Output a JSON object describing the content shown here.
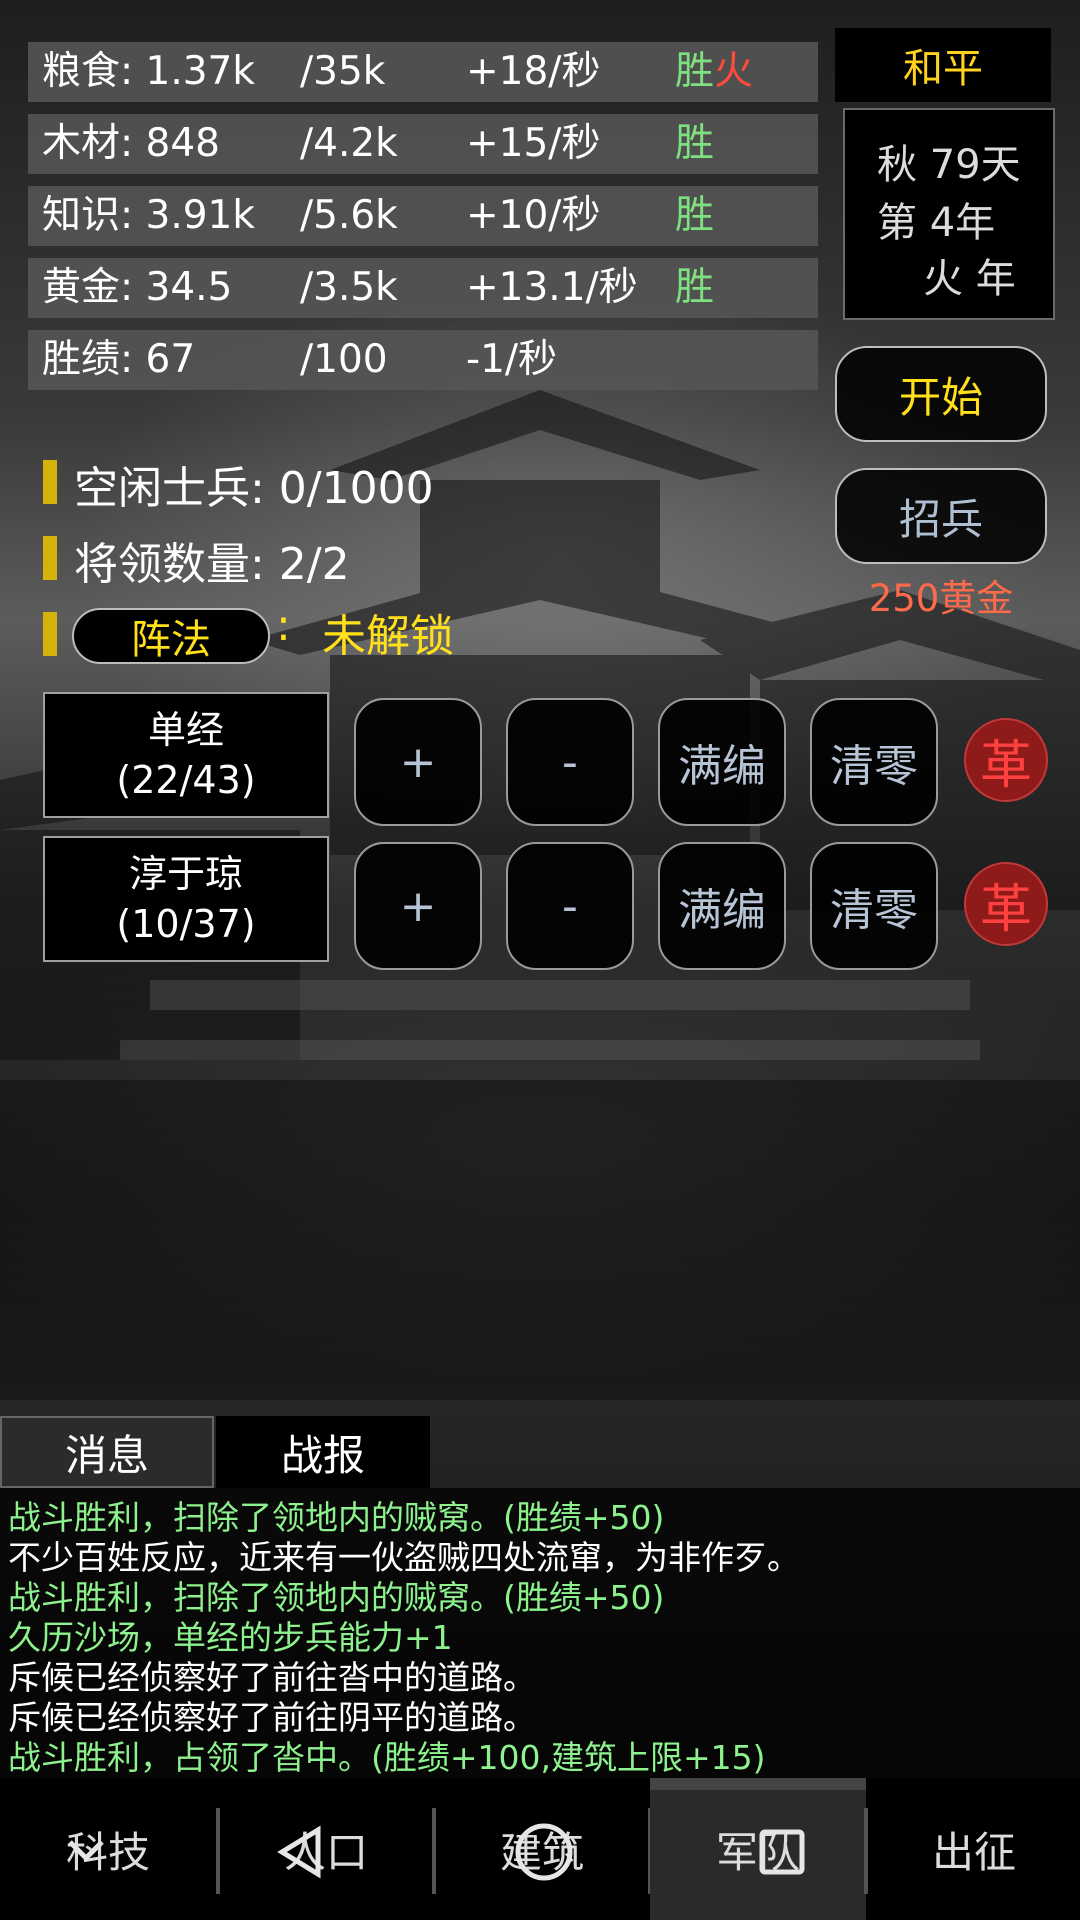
{
  "resources": [
    {
      "name": "粮食: 1.37k",
      "cap": "/35k",
      "rate": "+18/秒",
      "status": "胜",
      "extra": "火"
    },
    {
      "name": "木材: 848",
      "cap": "/4.2k",
      "rate": "+15/秒",
      "status": "胜",
      "extra": ""
    },
    {
      "name": "知识: 3.91k",
      "cap": "/5.6k",
      "rate": "+10/秒",
      "status": "胜",
      "extra": ""
    },
    {
      "name": "黄金: 34.5",
      "cap": "/3.5k",
      "rate": "+13.1/秒",
      "status": "胜",
      "extra": ""
    },
    {
      "name": "胜绩: 67",
      "cap": "/100",
      "rate": "-1/秒",
      "status": "",
      "extra": ""
    }
  ],
  "status_panel": {
    "state": "和平",
    "calendar": {
      "line1": "秋 79天",
      "line2": "第 4年",
      "line3": "火 年"
    },
    "start_label": "开始",
    "recruit_label": "招兵",
    "recruit_cost": "250黄金"
  },
  "military": {
    "idle_soldiers": "空闲士兵: 0/1000",
    "general_count": "将领数量: 2/2",
    "formation_label": "阵法",
    "formation_colon": ":",
    "formation_status": "未解锁"
  },
  "generals": [
    {
      "name": "单经",
      "troops": "(22/43)"
    },
    {
      "name": "淳于琼",
      "troops": "(10/37)"
    }
  ],
  "general_actions": {
    "add": "+",
    "remove": "-",
    "fill": "满编",
    "clear": "清零",
    "reform": "革"
  },
  "log_tabs": {
    "messages": "消息",
    "battle": "战报"
  },
  "log_lines": [
    {
      "text": "战斗胜利，扫除了领地内的贼窝。(胜绩+50)",
      "type": "good"
    },
    {
      "text": "不少百姓反应，近来有一伙盗贼四处流窜，为非作歹。",
      "type": "plain"
    },
    {
      "text": "战斗胜利，扫除了领地内的贼窝。(胜绩+50)",
      "type": "good"
    },
    {
      "text": "久历沙场，单经的步兵能力+1",
      "type": "good"
    },
    {
      "text": "斥候已经侦察好了前往沓中的道路。",
      "type": "plain"
    },
    {
      "text": "斥候已经侦察好了前往阴平的道路。",
      "type": "plain"
    },
    {
      "text": "战斗胜利，占领了沓中。(胜绩+100,建筑上限+15)",
      "type": "good"
    }
  ],
  "nav": [
    "科技",
    "人口",
    "建筑",
    "军队",
    "出征"
  ],
  "colors": {
    "win": "#7ee07e",
    "fire": "#ff4b3a",
    "gold": "#ffe01a",
    "log_good": "#8df28d",
    "cost": "#ff6a4a",
    "reform": "#ff4040"
  },
  "icons": [
    "back-icon",
    "home-icon",
    "recents-icon"
  ]
}
